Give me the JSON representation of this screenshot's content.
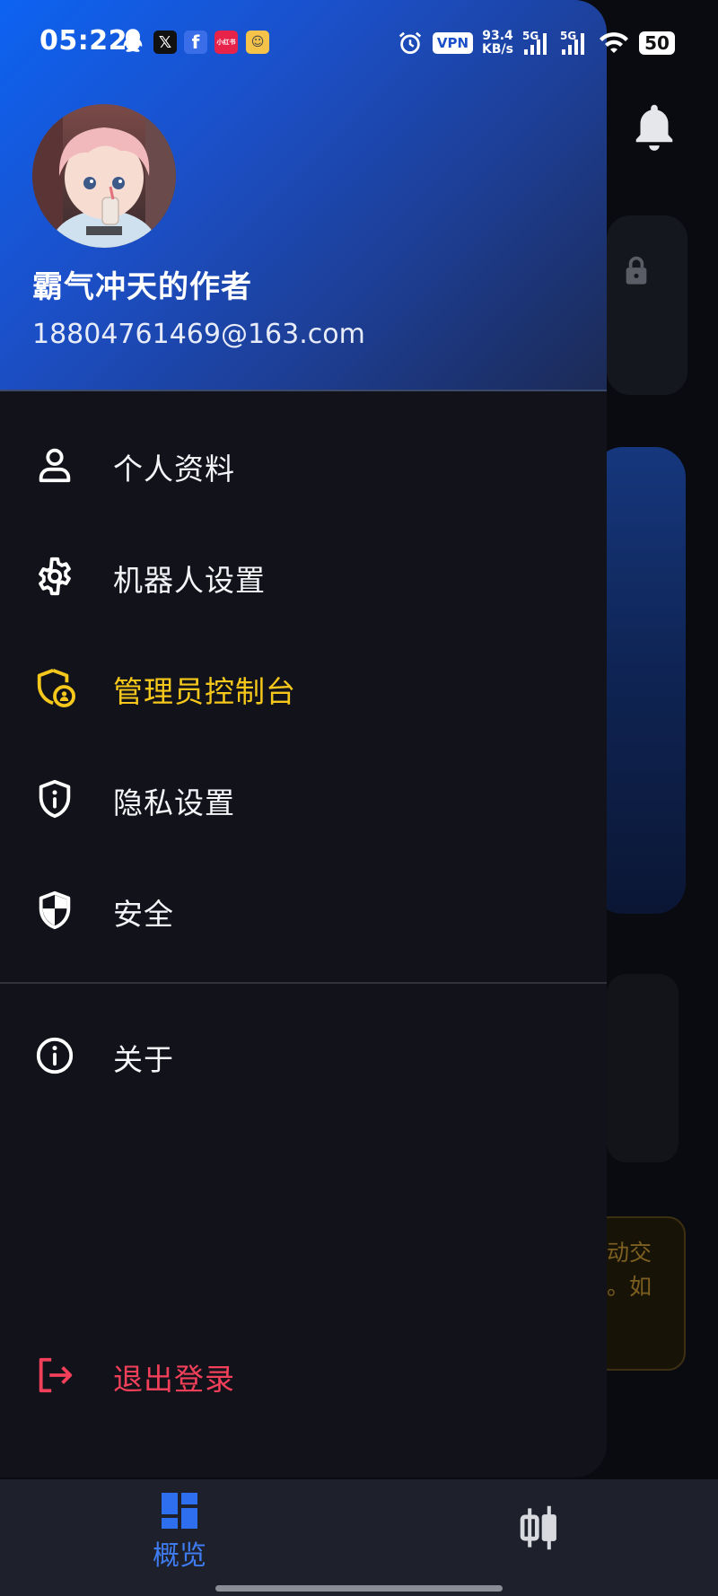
{
  "status_bar": {
    "time": "05:22",
    "vpn": "VPN",
    "speed_value": "93.4",
    "speed_unit": "KB/s",
    "network1": "5G",
    "network2": "5G",
    "battery": "50",
    "app_badge_red": "小红书"
  },
  "profile": {
    "name": "霸气冲天的作者",
    "email": "18804761469@163.com"
  },
  "menu": {
    "profile_label": "个人资料",
    "bot_settings_label": "机器人设置",
    "admin_console_label": "管理员控制台",
    "privacy_label": "隐私设置",
    "security_label": "安全",
    "about_label": "关于",
    "logout_label": "退出登录"
  },
  "background": {
    "warning_line1": "动交",
    "warning_line2": "。如"
  },
  "tabbar": {
    "overview_label": "概览"
  },
  "colors": {
    "accent_blue": "#0d63f2",
    "admin_yellow": "#f6c81b",
    "logout_red": "#f23f5a",
    "drawer_bg": "#12131a"
  }
}
